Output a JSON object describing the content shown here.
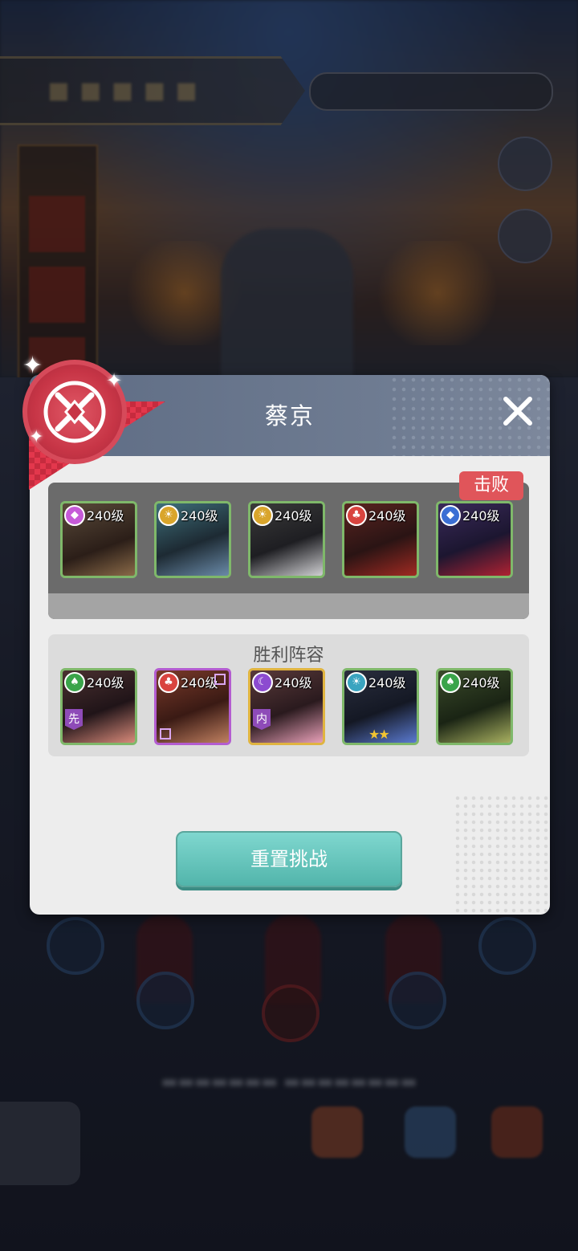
{
  "dialog": {
    "title": "蔡京",
    "close_icon": "close-icon",
    "defeated_badge": "击败",
    "victory_title": "胜利阵容",
    "reset_button": "重置挑战"
  },
  "enemy_team": [
    {
      "level": "240级",
      "faction": "diamond",
      "faction_color": "#c65ad8",
      "frame": "green"
    },
    {
      "level": "240级",
      "faction": "sun",
      "faction_color": "#d9a52b",
      "frame": "green"
    },
    {
      "level": "240级",
      "faction": "sun",
      "faction_color": "#d9a52b",
      "frame": "green"
    },
    {
      "level": "240级",
      "faction": "club",
      "faction_color": "#d9443f",
      "frame": "green"
    },
    {
      "level": "240级",
      "faction": "diamond",
      "faction_color": "#3b6fd4",
      "frame": "green"
    }
  ],
  "victory_team": [
    {
      "level": "240级",
      "faction": "spade",
      "faction_color": "#3aa44a",
      "frame": "green",
      "role": "先"
    },
    {
      "level": "240级",
      "faction": "club",
      "faction_color": "#d9443f",
      "frame": "purple"
    },
    {
      "level": "240级",
      "faction": "moon",
      "faction_color": "#8c4bd0",
      "frame": "gold",
      "role": "内"
    },
    {
      "level": "240级",
      "faction": "sun",
      "faction_color": "#3aa4c0",
      "frame": "green",
      "stars": "★★"
    },
    {
      "level": "240级",
      "faction": "spade",
      "faction_color": "#3aa44a",
      "frame": "green"
    }
  ],
  "colors": {
    "header": "#6a778e",
    "defeated": "#e0555a",
    "reset_button": "#5cc0b6",
    "emblem": "#c73546"
  }
}
